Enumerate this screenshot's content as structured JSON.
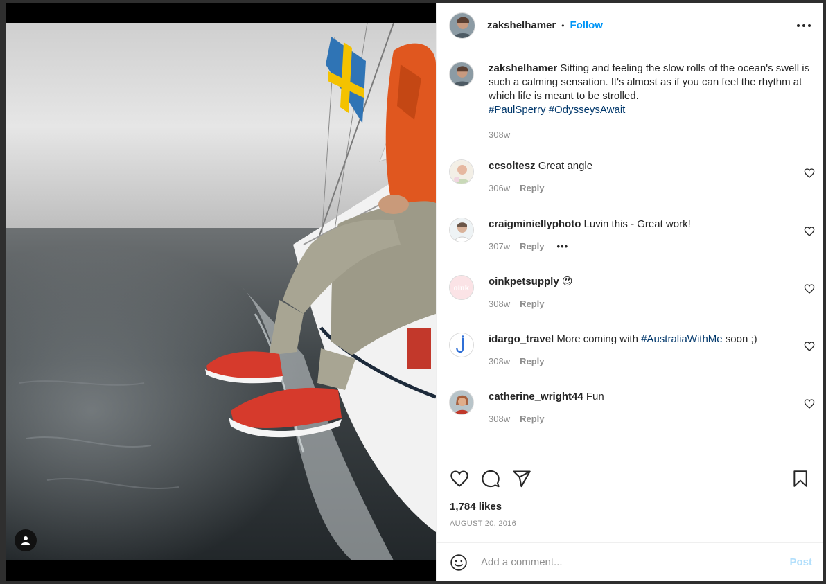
{
  "post": {
    "author": "zakshelhamer",
    "follow_label": "Follow",
    "separator": "•",
    "caption": {
      "username": "zakshelhamer",
      "text": " Sitting and feeling the slow rolls of the ocean's swell is such a calming sensation. It's almost as if you can feel the rhythm at which life is meant to be strolled.",
      "hashtag1": "#PaulSperry",
      "hashtag2": "#OdysseysAwait",
      "age": "308w"
    },
    "likes": "1,784 likes",
    "date": "AUGUST 20, 2016"
  },
  "comments": [
    {
      "username": "ccsoltesz",
      "text": " Great angle",
      "age": "306w",
      "reply": "Reply"
    },
    {
      "username": "craigminiellyphoto",
      "text": " Luvin this - Great work!",
      "age": "307w",
      "reply": "Reply",
      "more": "•••"
    },
    {
      "username": "oinkpetsupply",
      "text": " 😍",
      "age": "308w",
      "reply": "Reply",
      "avatar_text": "oink"
    },
    {
      "username": "idargo_travel",
      "text_before": " More coming with ",
      "hashtag": "#AustraliaWithMe",
      "text_after": " soon ;)",
      "age": "308w",
      "reply": "Reply"
    },
    {
      "username": "catherine_wright44",
      "text": " Fun",
      "age": "308w",
      "reply": "Reply"
    }
  ],
  "composer": {
    "placeholder": "Add a comment...",
    "post_label": "Post"
  },
  "icons": {
    "more": "more-horizontal-icon",
    "like": "heart-icon",
    "comment": "comment-bubble-icon",
    "share": "paper-plane-icon",
    "save": "bookmark-icon",
    "emoji": "smiley-icon",
    "tags": "user-tag-icon"
  },
  "colors": {
    "follow": "#0095f6",
    "hashtag": "#00376b",
    "muted": "#8e8e8e",
    "post_disabled": "#b2dffc"
  }
}
